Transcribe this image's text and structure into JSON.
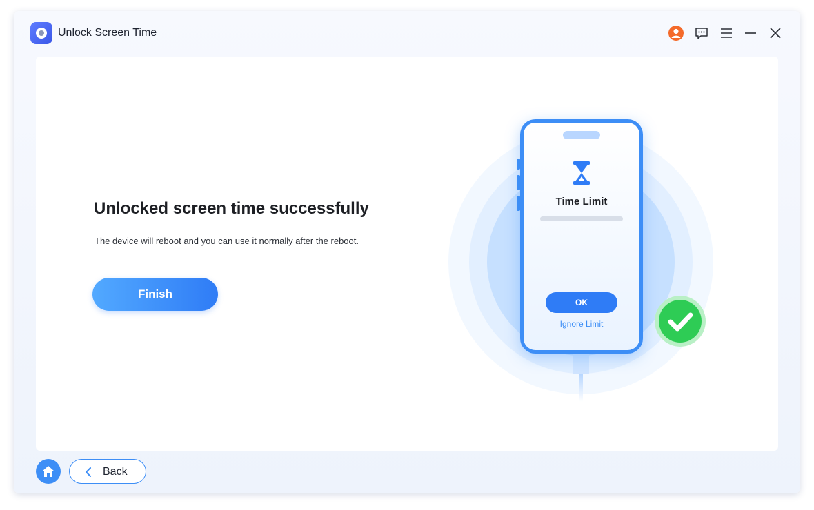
{
  "window": {
    "title": "Unlock Screen Time",
    "icons": [
      "app-logo-icon",
      "user-icon",
      "chat-icon",
      "menu-icon",
      "minimize-icon",
      "close-icon"
    ]
  },
  "main": {
    "headline": "Unlocked screen time successfully",
    "subtext": "The device will reboot and you can use it normally after the reboot.",
    "finish_label": "Finish"
  },
  "illustration": {
    "screen_title": "Time Limit",
    "ok_label": "OK",
    "ignore_label": "Ignore Limit",
    "icons": [
      "hourglass-icon",
      "success-check-icon"
    ]
  },
  "footer": {
    "back_label": "Back",
    "icons": [
      "home-icon",
      "chevron-left-icon"
    ]
  },
  "colors": {
    "accent": "#2f7cf6",
    "accent_light": "#52a9ff",
    "success": "#2ecc55",
    "user_badge": "#f46a2a"
  }
}
